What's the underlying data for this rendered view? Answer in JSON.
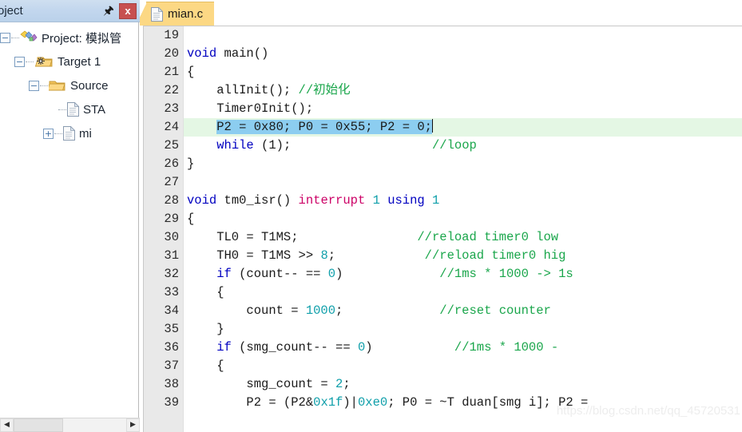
{
  "project_pane": {
    "title": "roject",
    "pin_icon": "pin-icon",
    "close_label": "x",
    "tree": [
      {
        "indent": 0,
        "expander": "minus",
        "icon": "project-icon",
        "label": "Project: 模拟管"
      },
      {
        "indent": 1,
        "expander": "minus",
        "icon": "target-icon",
        "label": "Target 1"
      },
      {
        "indent": 2,
        "expander": "minus",
        "icon": "folder-icon",
        "label": "Source"
      },
      {
        "indent": 3,
        "expander": "none",
        "icon": "file-icon",
        "label": "STA"
      },
      {
        "indent": 3,
        "expander": "plus",
        "icon": "file-icon",
        "label": "mi"
      }
    ],
    "scrollbar": {
      "left_arrow": "◀",
      "right_arrow": "▶"
    }
  },
  "editor": {
    "tab": {
      "label": "mian.c",
      "icon": "file-icon"
    },
    "watermark": "https://blog.csdn.net/qq_45720531",
    "first_line_number": 19,
    "current_line": 24,
    "lines": [
      {
        "num": 19,
        "tokens": []
      },
      {
        "num": 20,
        "tokens": [
          {
            "t": "void",
            "c": "k"
          },
          {
            "t": " main()",
            "c": "p"
          }
        ]
      },
      {
        "num": 21,
        "tokens": [
          {
            "t": "{",
            "c": "p"
          }
        ]
      },
      {
        "num": 22,
        "tokens": [
          {
            "t": "    allInit(); ",
            "c": "p"
          },
          {
            "t": "//初始化",
            "c": "c"
          }
        ]
      },
      {
        "num": 23,
        "tokens": [
          {
            "t": "    Timer0Init();",
            "c": "p"
          }
        ]
      },
      {
        "num": 24,
        "selected": true,
        "tokens": [
          {
            "t": "    ",
            "c": "p"
          },
          {
            "t": "P2 = 0x80; P0 = 0x55; P2 = 0;",
            "c": "p sel"
          }
        ]
      },
      {
        "num": 25,
        "tokens": [
          {
            "t": "    ",
            "c": "p"
          },
          {
            "t": "while",
            "c": "k"
          },
          {
            "t": " (1);                   ",
            "c": "p"
          },
          {
            "t": "//loop",
            "c": "c"
          }
        ]
      },
      {
        "num": 26,
        "tokens": [
          {
            "t": "}",
            "c": "p"
          }
        ]
      },
      {
        "num": 27,
        "tokens": []
      },
      {
        "num": 28,
        "tokens": [
          {
            "t": "void",
            "c": "k"
          },
          {
            "t": " tm0_isr() ",
            "c": "p"
          },
          {
            "t": "interrupt",
            "c": "kw2"
          },
          {
            "t": " ",
            "c": "p"
          },
          {
            "t": "1",
            "c": "n"
          },
          {
            "t": " ",
            "c": "p"
          },
          {
            "t": "using",
            "c": "k"
          },
          {
            "t": " ",
            "c": "p"
          },
          {
            "t": "1",
            "c": "n"
          }
        ]
      },
      {
        "num": 29,
        "tokens": [
          {
            "t": "{",
            "c": "p"
          }
        ]
      },
      {
        "num": 30,
        "tokens": [
          {
            "t": "    TL0 = T1MS;                ",
            "c": "p"
          },
          {
            "t": "//reload timer0 low",
            "c": "c"
          }
        ]
      },
      {
        "num": 31,
        "tokens": [
          {
            "t": "    TH0 = T1MS >> ",
            "c": "p"
          },
          {
            "t": "8",
            "c": "n"
          },
          {
            "t": ";            ",
            "c": "p"
          },
          {
            "t": "//reload timer0 hig",
            "c": "c"
          }
        ]
      },
      {
        "num": 32,
        "tokens": [
          {
            "t": "    ",
            "c": "p"
          },
          {
            "t": "if",
            "c": "k"
          },
          {
            "t": " (count-- == ",
            "c": "p"
          },
          {
            "t": "0",
            "c": "n"
          },
          {
            "t": ")             ",
            "c": "p"
          },
          {
            "t": "//1ms * 1000 -> 1s",
            "c": "c"
          }
        ]
      },
      {
        "num": 33,
        "tokens": [
          {
            "t": "    {",
            "c": "p"
          }
        ]
      },
      {
        "num": 34,
        "tokens": [
          {
            "t": "        count = ",
            "c": "p"
          },
          {
            "t": "1000",
            "c": "n"
          },
          {
            "t": ";             ",
            "c": "p"
          },
          {
            "t": "//reset counter",
            "c": "c"
          }
        ]
      },
      {
        "num": 35,
        "tokens": [
          {
            "t": "    }",
            "c": "p"
          }
        ]
      },
      {
        "num": 36,
        "tokens": [
          {
            "t": "    ",
            "c": "p"
          },
          {
            "t": "if",
            "c": "k"
          },
          {
            "t": " (smg_count-- == ",
            "c": "p"
          },
          {
            "t": "0",
            "c": "n"
          },
          {
            "t": ")           ",
            "c": "p"
          },
          {
            "t": "//1ms * 1000 -",
            "c": "c"
          }
        ]
      },
      {
        "num": 37,
        "tokens": [
          {
            "t": "    {",
            "c": "p"
          }
        ]
      },
      {
        "num": 38,
        "tokens": [
          {
            "t": "        smg_count = ",
            "c": "p"
          },
          {
            "t": "2",
            "c": "n"
          },
          {
            "t": ";",
            "c": "p"
          }
        ]
      },
      {
        "num": 39,
        "tokens": [
          {
            "t": "        P2 = (P2&",
            "c": "p"
          },
          {
            "t": "0x1f",
            "c": "n"
          },
          {
            "t": ")|",
            "c": "p"
          },
          {
            "t": "0xe0",
            "c": "n"
          },
          {
            "t": "; P0 = ~T duan[smg i]; P2 = ",
            "c": "p"
          }
        ]
      }
    ]
  }
}
